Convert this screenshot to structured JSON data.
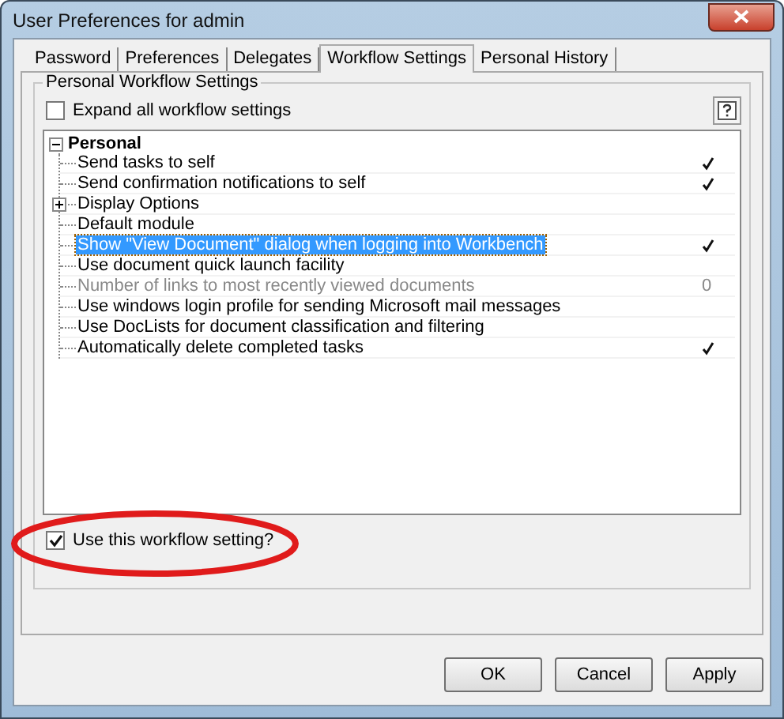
{
  "window": {
    "title": "User Preferences for admin"
  },
  "tabs": [
    {
      "label": "Password",
      "selected": false
    },
    {
      "label": "Preferences",
      "selected": false
    },
    {
      "label": "Delegates",
      "selected": false
    },
    {
      "label": "Workflow Settings",
      "selected": true
    },
    {
      "label": "Personal History",
      "selected": false
    }
  ],
  "group": {
    "title": "Personal Workflow Settings",
    "expand_all": {
      "label": "Expand all workflow settings",
      "checked": false
    },
    "tree": {
      "label": "Personal",
      "expanded": true,
      "children": [
        {
          "kind": "setting",
          "label": "Send tasks to self",
          "checked": true,
          "selected": false,
          "disabled": false
        },
        {
          "kind": "setting",
          "label": "Send confirmation notifications to self",
          "checked": true,
          "selected": false,
          "disabled": false
        },
        {
          "kind": "group",
          "label": "Display Options",
          "expanded": false,
          "checked": false,
          "selected": false,
          "disabled": false
        },
        {
          "kind": "setting",
          "label": "Default module",
          "checked": false,
          "selected": false,
          "disabled": false
        },
        {
          "kind": "setting",
          "label": "Show \"View Document\" dialog when logging into Workbench",
          "checked": true,
          "selected": true,
          "disabled": false
        },
        {
          "kind": "setting",
          "label": "Use document quick launch facility",
          "checked": false,
          "selected": false,
          "disabled": false
        },
        {
          "kind": "number",
          "label": "Number of links to most recently viewed documents",
          "value": "0",
          "selected": false,
          "disabled": true
        },
        {
          "kind": "setting",
          "label": "Use windows login profile for sending Microsoft mail messages",
          "checked": false,
          "selected": false,
          "disabled": false
        },
        {
          "kind": "setting",
          "label": "Use DocLists for document classification and filtering",
          "checked": false,
          "selected": false,
          "disabled": false
        },
        {
          "kind": "setting",
          "label": "Automatically delete completed tasks",
          "checked": true,
          "selected": false,
          "disabled": false
        }
      ]
    },
    "use_setting": {
      "label": "Use this workflow setting?",
      "checked": true,
      "highlighted": true
    }
  },
  "buttons": [
    {
      "label": "OK"
    },
    {
      "label": "Cancel"
    },
    {
      "label": "Apply"
    }
  ]
}
